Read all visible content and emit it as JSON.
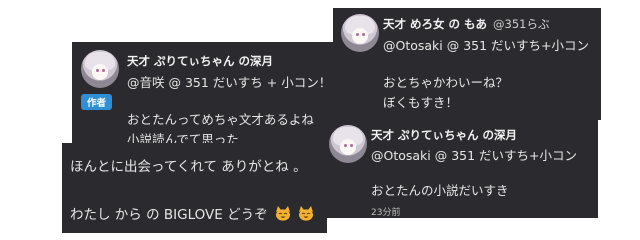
{
  "card_a": {
    "author": "天才 ぷりてぃちゃん の深月",
    "line1": "@音咲 @ 351 だいすち + 小コン！！",
    "badge": "作者",
    "line2": "おとたんってめちゃ文才あるよね",
    "line3": "小説読んでて思った"
  },
  "card_b": {
    "author": "天才 めろ女 の もあ",
    "handle": "@351らぶ",
    "line1": "@Otosaki @ 351 だいすち+小コン",
    "line2": "おとちゃかわいーね？",
    "line3": "ぼくもすき！"
  },
  "card_c": {
    "line1": "ほんとに出会ってくれて ありがとね 。",
    "line2": "わたし から の  BIGLOVE どうぞ"
  },
  "card_d": {
    "author": "天才 ぷりてぃちゃん の深月",
    "line1": "@Otosaki @ 351 だいすち+小コン",
    "line2": "おとたんの小説だいすき",
    "time": "23分前"
  },
  "icons": [
    "smiling-cat-emoji",
    "smiling-cat-emoji"
  ],
  "colors": {
    "card": "#2b2b2f",
    "badge": "#2f8fd6",
    "emoji": "#f2b230"
  }
}
